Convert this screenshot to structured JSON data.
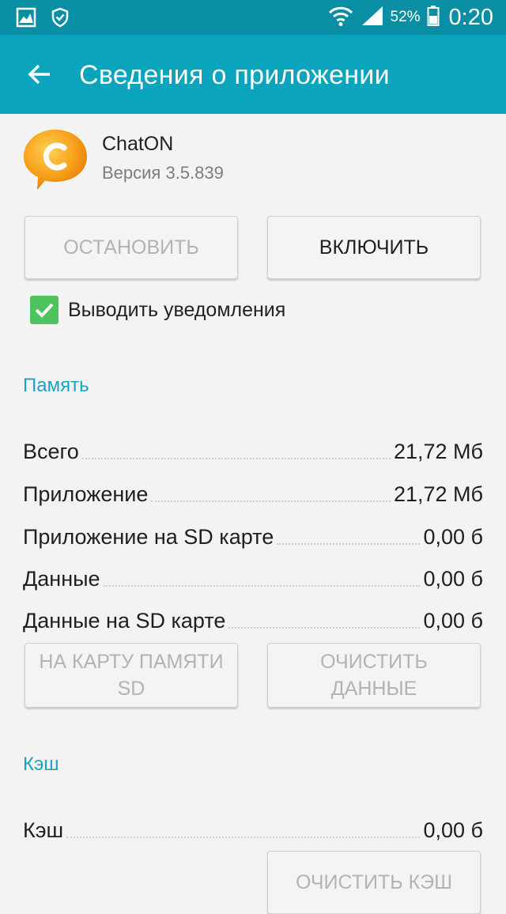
{
  "status_bar": {
    "icons_left": [
      "gallery-icon",
      "shield-check-icon"
    ],
    "icons_right": [
      "wifi-icon",
      "signal-icon",
      "battery-icon"
    ],
    "battery_percent": "52%",
    "clock": "0:20"
  },
  "app_bar": {
    "title": "Сведения о приложении",
    "color": "#0aa4bd"
  },
  "app": {
    "name": "ChatON",
    "version": "Версия 3.5.839",
    "icon_letter": "C",
    "icon_color": "#f5a21b"
  },
  "buttons": {
    "stop": "ОСТАНОВИТЬ",
    "enable": "ВКЛЮЧИТЬ",
    "move_sd_line1": "НА КАРТУ ПАМЯТИ",
    "move_sd_line2": "SD",
    "clear_data_line1": "ОЧИСТИТЬ",
    "clear_data_line2": "ДАННЫЕ",
    "clear_cache": "ОЧИСТИТЬ КЭШ"
  },
  "notifications": {
    "label": "Выводить уведомления",
    "checked": true
  },
  "memory": {
    "section_title": "Память",
    "rows": [
      {
        "label": "Всего",
        "value": "21,72 Мб"
      },
      {
        "label": "Приложение",
        "value": "21,72 Мб"
      },
      {
        "label": "Приложение на SD карте",
        "value": "0,00 б"
      },
      {
        "label": "Данные",
        "value": "0,00 б"
      },
      {
        "label": "Данные на SD карте",
        "value": "0,00 б"
      }
    ]
  },
  "cache": {
    "section_title": "Кэш",
    "rows": [
      {
        "label": "Кэш",
        "value": "0,00 б"
      }
    ]
  },
  "colors": {
    "status_bar": "#0a8ea3",
    "accent": "#1aa3c3",
    "checkbox": "#4fc35e",
    "background": "#f3f3f3"
  }
}
